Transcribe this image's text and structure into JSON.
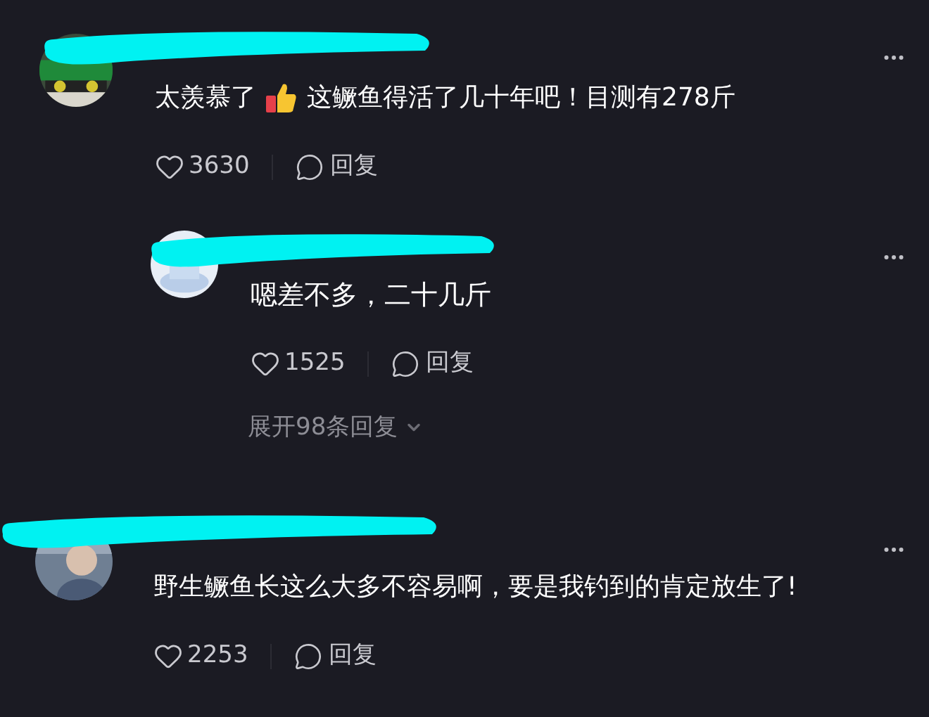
{
  "comments": [
    {
      "kind": "comment",
      "segments": [
        {
          "kind": "text",
          "text": "太羡慕了"
        },
        {
          "kind": "emoji"
        },
        {
          "kind": "text",
          "text": "这鳜鱼得活了几十年吧！目测有278斤"
        }
      ],
      "likes": "3630",
      "reply_label": "回复"
    },
    {
      "kind": "reply",
      "segments": [
        {
          "kind": "text",
          "text": "嗯差不多，二十几斤"
        }
      ],
      "likes": "1525",
      "reply_label": "回复",
      "expand_label": "展开98条回复"
    },
    {
      "kind": "comment",
      "segments": [
        {
          "kind": "text",
          "text": "野生鳜鱼长这么大多不容易啊，要是我钓到的肯定放生了!"
        }
      ],
      "likes": "2253",
      "reply_label": "回复"
    }
  ]
}
